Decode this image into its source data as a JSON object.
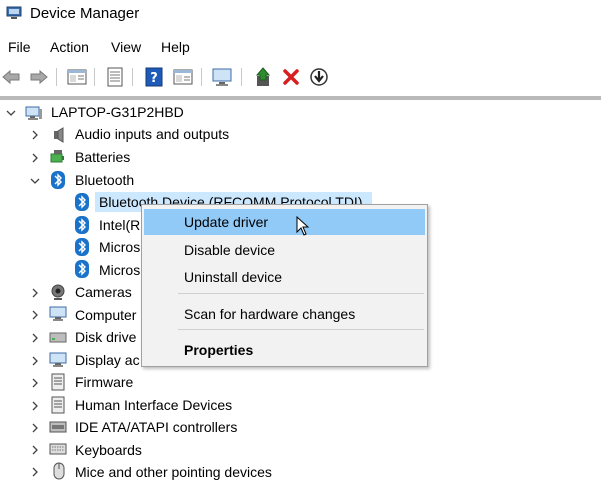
{
  "window": {
    "title": "Device Manager"
  },
  "menu": [
    "File",
    "Action",
    "View",
    "Help"
  ],
  "toolbar": {
    "icons": [
      "back-arrow-icon",
      "forward-arrow-icon",
      "properties-icon",
      "list-view-icon",
      "help-icon",
      "show-hidden-icon",
      "monitor-scan-icon",
      "update-driver-icon",
      "uninstall-x-icon",
      "download-circle-icon"
    ],
    "colors": {
      "uninstall": "#d81e1e",
      "help": "#1e5bb8",
      "update": "#2e8b2e"
    }
  },
  "tree": {
    "root": "LAPTOP-G31P2HBD",
    "categories": [
      {
        "label": "Audio inputs and outputs",
        "icon": "speaker-icon",
        "expanded": false
      },
      {
        "label": "Batteries",
        "icon": "battery-icon",
        "expanded": false
      },
      {
        "label": "Bluetooth",
        "icon": "bluetooth-icon",
        "expanded": true
      },
      {
        "label": "Cameras",
        "icon": "camera-icon",
        "expanded": false
      },
      {
        "label": "Computer",
        "icon": "computer-icon",
        "expanded": false
      },
      {
        "label": "Disk drive",
        "icon": "disk-drive-icon",
        "expanded": false
      },
      {
        "label": "Display ac",
        "icon": "display-adapter-icon",
        "expanded": false
      },
      {
        "label": "Firmware",
        "icon": "firmware-icon",
        "expanded": false
      },
      {
        "label": "Human Interface Devices",
        "icon": "hid-icon",
        "expanded": false
      },
      {
        "label": "IDE ATA/ATAPI controllers",
        "icon": "ide-controller-icon",
        "expanded": false
      },
      {
        "label": "Keyboards",
        "icon": "keyboard-icon",
        "expanded": false
      },
      {
        "label": "Mice and other pointing devices",
        "icon": "mouse-icon",
        "expanded": false
      }
    ],
    "bluetooth_children": [
      "Bluetooth Device (RFCOMM Protocol TDI)",
      "Intel(R",
      "Micros",
      "Micros"
    ],
    "selection_color": "#cce8ff"
  },
  "context_menu": {
    "items": [
      "Update driver",
      "Disable device",
      "Uninstall device",
      "Scan for hardware changes",
      "Properties"
    ],
    "highlight_color": "#91c9f7"
  }
}
